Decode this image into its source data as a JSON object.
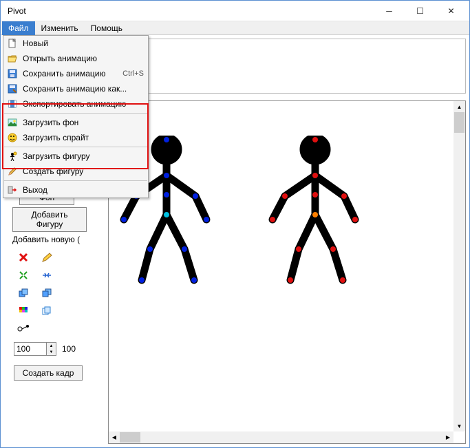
{
  "window": {
    "title": "Pivot"
  },
  "menubar": {
    "file": "Файл",
    "edit": "Изменить",
    "help": "Помощь"
  },
  "file_menu": {
    "new": "Новый",
    "open": "Открыть анимацию",
    "save": "Сохранить анимацию",
    "save_shortcut": "Ctrl+S",
    "save_as": "Сохранить анимацию как...",
    "export": "Экспортировать анимацию",
    "load_bg": "Загрузить фон",
    "load_sprite": "Загрузить спрайт",
    "load_figure": "Загрузить фигуру",
    "create_figure": "Создать фигуру",
    "exit": "Выход"
  },
  "side": {
    "bg_btn": "Фон",
    "add_figure_btn": "Добавить Фигуру",
    "add_new_label": "Добавить новую (",
    "scale_value": "100",
    "scale_label": "100",
    "create_frame": "Создать кадр"
  },
  "icons": {
    "new": "file-new-icon",
    "open": "folder-open-icon",
    "save": "disk-save-icon",
    "save_as": "disk-edit-icon",
    "export": "film-export-icon",
    "load_bg": "landscape-icon",
    "load_sprite": "smiley-icon",
    "load_figure": "person-icon",
    "create_figure": "pencil-icon",
    "exit": "exit-icon"
  }
}
